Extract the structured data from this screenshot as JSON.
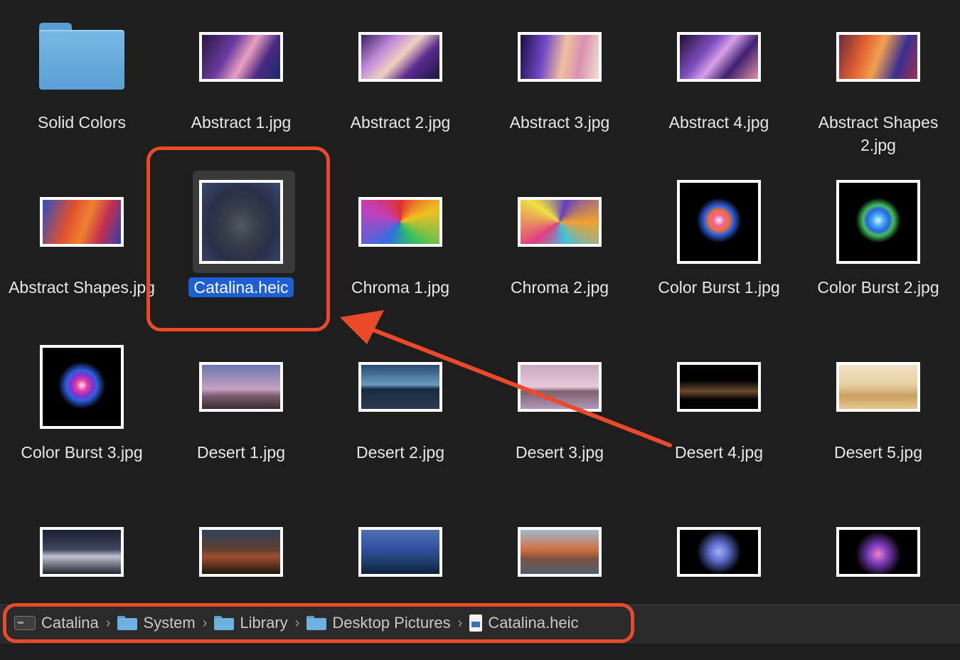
{
  "items": [
    {
      "label": "Solid Colors",
      "kind": "folder",
      "thumb": "folder",
      "bg": "linear-gradient(#78b9e6,#5aa0d4)"
    },
    {
      "label": "Abstract 1.jpg",
      "kind": "image",
      "thumb": "wide",
      "bg": "linear-gradient(120deg,#2a1840,#6a3aa0 35%,#e7a0c0 55%,#4a2a80 75%,#1a2a70)"
    },
    {
      "label": "Abstract 2.jpg",
      "kind": "image",
      "thumb": "wide",
      "bg": "linear-gradient(135deg,#3a2060,#c08ad8 30%,#f0d0c0 50%,#5a2a90 70%,#1a1840)"
    },
    {
      "label": "Abstract 3.jpg",
      "kind": "image",
      "thumb": "wide",
      "bg": "linear-gradient(100deg,#1a1040,#7048c8 30%,#f0c0a0 55%,#d890b0 75%,#f0e0d0)"
    },
    {
      "label": "Abstract 4.jpg",
      "kind": "image",
      "thumb": "wide",
      "bg": "linear-gradient(130deg,#201030,#8050c0 35%,#d8a0e8 50%,#402070 70%,#e090a0)"
    },
    {
      "label": "Abstract Shapes 2.jpg",
      "kind": "image",
      "thumb": "wide",
      "bg": "linear-gradient(110deg,#6a2a40,#e06030 30%,#f0a050 50%,#3a3090 75%,#a03050)"
    },
    {
      "label": "Abstract Shapes.jpg",
      "kind": "image",
      "thumb": "wide",
      "bg": "linear-gradient(110deg,#2a50c0,#e05030 35%,#f08030 55%,#c03050 75%,#3040b0)"
    },
    {
      "label": "Catalina.heic",
      "kind": "image",
      "thumb": "square",
      "selected": true,
      "bg": "radial-gradient(ellipse at 50% 55%,#505a60 0%,#383e4a 30%,#2a3048 60%,#3a4a70 100%)"
    },
    {
      "label": "Chroma 1.jpg",
      "kind": "image",
      "thumb": "wide",
      "bg": "conic-gradient(from 0deg,#e03030,#f0c020,#30c060,#3070e0,#c040c0,#e03030)"
    },
    {
      "label": "Chroma 2.jpg",
      "kind": "image",
      "thumb": "wide",
      "bg": "conic-gradient(from 90deg,#f0a030,#40c0e0,#e04080,#f0e040,#6040c0,#f0a030)"
    },
    {
      "label": "Color Burst 1.jpg",
      "kind": "image",
      "thumb": "square",
      "bg": "radial-gradient(circle at 50% 48%,#f0f0f0 0%,#f060a0 10%,#f07030 18%,#3060e0 26%,#000 40%)"
    },
    {
      "label": "Color Burst 2.jpg",
      "kind": "image",
      "thumb": "square",
      "bg": "radial-gradient(circle at 50% 48%,#e0f0ff 0%,#40b0f0 10%,#3060e0 20%,#40c060 27%,#000 40%)"
    },
    {
      "label": "Color Burst 3.jpg",
      "kind": "image",
      "thumb": "square",
      "bg": "radial-gradient(circle at 50% 48%,#ffe0f0 0%,#e040a0 10%,#8030d0 20%,#3060e0 27%,#000 42%)"
    },
    {
      "label": "Desert 1.jpg",
      "kind": "image",
      "thumb": "wide",
      "bg": "linear-gradient(#6a78b0,#c8a0c0 55%,#7a6070 70%,#3a2a30)"
    },
    {
      "label": "Desert 2.jpg",
      "kind": "image",
      "thumb": "wide",
      "bg": "linear-gradient(#2a4a70,#6a9ac0 45%,#1a2a40 55%,#2a3a50)"
    },
    {
      "label": "Desert 3.jpg",
      "kind": "image",
      "thumb": "wide",
      "bg": "linear-gradient(#c8a8c0,#e8c8d8 50%,#806070 60%,#b098b8)"
    },
    {
      "label": "Desert 4.jpg",
      "kind": "image",
      "thumb": "wide",
      "bg": "linear-gradient(#000 35%,#6a4a30 60%,#000 80%)"
    },
    {
      "label": "Desert 5.jpg",
      "kind": "image",
      "thumb": "wide",
      "bg": "linear-gradient(#f0e0c8,#e8d0a0 45%,#c8a060 70%,#e8c890)"
    },
    {
      "label": "",
      "kind": "image",
      "thumb": "wide",
      "bg": "linear-gradient(#1a2030,#404860 45%,#c0c0d0 60%,#202430)"
    },
    {
      "label": "",
      "kind": "image",
      "thumb": "wide",
      "bg": "linear-gradient(#30405a,#604030 45%,#a05030 60%,#201810)"
    },
    {
      "label": "",
      "kind": "image",
      "thumb": "wide",
      "bg": "linear-gradient(#5070b0,#3050a0 45%,#204070 70%,#102040)"
    },
    {
      "label": "",
      "kind": "image",
      "thumb": "wide",
      "bg": "linear-gradient(#a0b8d0,#d07040 45%,#805040 65%,#506070)"
    },
    {
      "label": "",
      "kind": "image",
      "thumb": "wide",
      "bg": "radial-gradient(circle at 50% 50%,#a0b0f0 0%,#6070d0 20%,#000 50%)"
    },
    {
      "label": "",
      "kind": "image",
      "thumb": "wide",
      "bg": "radial-gradient(circle at 50% 55%,#f080c0 0%,#8040c0 20%,#000 50%)"
    }
  ],
  "pathbar": {
    "crumbs": [
      {
        "label": "Catalina",
        "icon": "disk-icon"
      },
      {
        "label": "System",
        "icon": "folder-icon"
      },
      {
        "label": "Library",
        "icon": "folder-icon"
      },
      {
        "label": "Desktop Pictures",
        "icon": "folder-icon"
      },
      {
        "label": "Catalina.heic",
        "icon": "document-icon"
      }
    ],
    "separator": "›"
  },
  "annotation": {
    "color": "#ea4a2a"
  }
}
